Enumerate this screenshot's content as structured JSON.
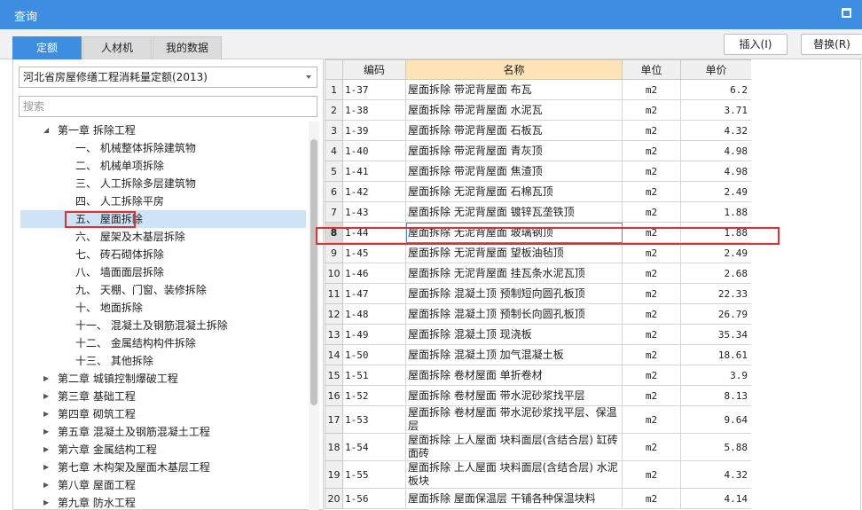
{
  "window": {
    "title": "查询"
  },
  "tabs": [
    {
      "label": "定额",
      "active": true
    },
    {
      "label": "人材机",
      "active": false
    },
    {
      "label": "我的数据",
      "active": false
    }
  ],
  "buttons": {
    "insert": "插入(I)",
    "replace": "替换(R)"
  },
  "left": {
    "dropdown_value": "河北省房屋修缮工程消耗量定额(2013)",
    "search_placeholder": "搜索",
    "tree": [
      {
        "label": "第一章 拆除工程",
        "level": 0,
        "expanded": true
      },
      {
        "label": "一、 机械整体拆除建筑物",
        "level": 1
      },
      {
        "label": "二、 机械单项拆除",
        "level": 1
      },
      {
        "label": "三、 人工拆除多层建筑物",
        "level": 1
      },
      {
        "label": "四、 人工拆除平房",
        "level": 1
      },
      {
        "label": "五、 屋面拆除",
        "level": 1,
        "selected": true
      },
      {
        "label": "六、 屋架及木基层拆除",
        "level": 1
      },
      {
        "label": "七、 砖石砌体拆除",
        "level": 1
      },
      {
        "label": "八、 墙面面层拆除",
        "level": 1
      },
      {
        "label": "九、 天棚、门窗、装修拆除",
        "level": 1
      },
      {
        "label": "十、 地面拆除",
        "level": 1
      },
      {
        "label": "十一、 混凝土及钢筋混凝土拆除",
        "level": 1
      },
      {
        "label": "十二、 金属结构构件拆除",
        "level": 1
      },
      {
        "label": "十三、 其他拆除",
        "level": 1
      },
      {
        "label": "第二章 城镇控制爆破工程",
        "level": 0
      },
      {
        "label": "第三章 基础工程",
        "level": 0
      },
      {
        "label": "第四章 砌筑工程",
        "level": 0
      },
      {
        "label": "第五章 混凝土及钢筋混凝土工程",
        "level": 0
      },
      {
        "label": "第六章 金属结构工程",
        "level": 0
      },
      {
        "label": "第七章 木构架及屋面木基层工程",
        "level": 0
      },
      {
        "label": "第八章 屋面工程",
        "level": 0
      },
      {
        "label": "第九章 防水工程",
        "level": 0
      }
    ]
  },
  "grid": {
    "headers": {
      "code": "编码",
      "name": "名称",
      "unit": "单位",
      "price": "单价"
    },
    "rows": [
      {
        "idx": "1",
        "code": "1-37",
        "name": "屋面拆除 带泥背屋面 布瓦",
        "unit": "m2",
        "price": "6.2"
      },
      {
        "idx": "2",
        "code": "1-38",
        "name": "屋面拆除 带泥背屋面 水泥瓦",
        "unit": "m2",
        "price": "3.71"
      },
      {
        "idx": "3",
        "code": "1-39",
        "name": "屋面拆除 带泥背屋面 石板瓦",
        "unit": "m2",
        "price": "4.32"
      },
      {
        "idx": "4",
        "code": "1-40",
        "name": "屋面拆除 带泥背屋面 青灰顶",
        "unit": "m2",
        "price": "4.98"
      },
      {
        "idx": "5",
        "code": "1-41",
        "name": "屋面拆除 带泥背屋面 焦渣顶",
        "unit": "m2",
        "price": "4.98"
      },
      {
        "idx": "6",
        "code": "1-42",
        "name": "屋面拆除 无泥背屋面 石棉瓦顶",
        "unit": "m2",
        "price": "2.49"
      },
      {
        "idx": "7",
        "code": "1-43",
        "name": "屋面拆除 无泥背屋面 镀锌瓦垄铁顶",
        "unit": "m2",
        "price": "1.88"
      },
      {
        "idx": "8",
        "code": "1-44",
        "name": "屋面拆除 无泥背屋面 玻璃钢顶",
        "unit": "m2",
        "price": "1.88",
        "selected": true
      },
      {
        "idx": "9",
        "code": "1-45",
        "name": "屋面拆除 无泥背屋面 望板油毡顶",
        "unit": "m2",
        "price": "2.49"
      },
      {
        "idx": "10",
        "code": "1-46",
        "name": "屋面拆除 无泥背屋面 挂瓦条水泥瓦顶",
        "unit": "m2",
        "price": "2.68"
      },
      {
        "idx": "11",
        "code": "1-47",
        "name": "屋面拆除 混凝土顶 预制短向圆孔板顶",
        "unit": "m2",
        "price": "22.33"
      },
      {
        "idx": "12",
        "code": "1-48",
        "name": "屋面拆除 混凝土顶 预制长向圆孔板顶",
        "unit": "m2",
        "price": "26.79"
      },
      {
        "idx": "13",
        "code": "1-49",
        "name": "屋面拆除 混凝土顶 现浇板",
        "unit": "m2",
        "price": "35.34"
      },
      {
        "idx": "14",
        "code": "1-50",
        "name": "屋面拆除 混凝土顶 加气混凝土板",
        "unit": "m2",
        "price": "18.61"
      },
      {
        "idx": "15",
        "code": "1-51",
        "name": "屋面拆除 卷材屋面 单折卷材",
        "unit": "m2",
        "price": "3.9"
      },
      {
        "idx": "16",
        "code": "1-52",
        "name": "屋面拆除 卷材屋面 带水泥砂浆找平层",
        "unit": "m2",
        "price": "8.13"
      },
      {
        "idx": "17",
        "code": "1-53",
        "name": "屋面拆除 卷材屋面 带水泥砂浆找平层、保温层",
        "unit": "m2",
        "price": "9.64",
        "tall": true
      },
      {
        "idx": "18",
        "code": "1-54",
        "name": "屋面拆除 上人屋面 块料面层(含结合层) 缸砖面砖",
        "unit": "m2",
        "price": "5.88",
        "tall": true
      },
      {
        "idx": "19",
        "code": "1-55",
        "name": "屋面拆除 上人屋面 块料面层(含结合层) 水泥板块",
        "unit": "m2",
        "price": "4.32",
        "tall": true
      },
      {
        "idx": "20",
        "code": "1-56",
        "name": "屋面拆除 屋面保温层 干铺各种保温块料",
        "unit": "m2",
        "price": "4.14"
      }
    ]
  }
}
